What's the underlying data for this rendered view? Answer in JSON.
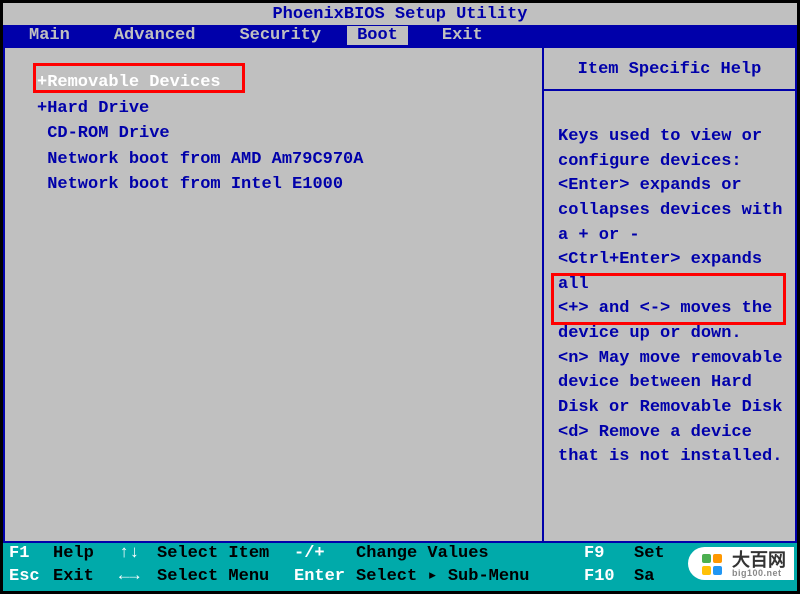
{
  "title": "PhoenixBIOS Setup Utility",
  "menu": {
    "items": [
      "Main",
      "Advanced",
      "Security",
      "Boot",
      "Exit"
    ],
    "active_index": 3
  },
  "boot_order": {
    "items": [
      {
        "prefix": "+",
        "label": "Removable Devices",
        "selected": true
      },
      {
        "prefix": "+",
        "label": "Hard Drive",
        "selected": false
      },
      {
        "prefix": " ",
        "label": "CD-ROM Drive",
        "selected": false
      },
      {
        "prefix": " ",
        "label": "Network boot from AMD Am79C970A",
        "selected": false
      },
      {
        "prefix": " ",
        "label": "Network boot from Intel E1000",
        "selected": false
      }
    ]
  },
  "help": {
    "title": "Item Specific Help",
    "body_lines": [
      "Keys used to view or",
      "configure devices:",
      "<Enter> expands or",
      "collapses devices with",
      "a + or -",
      "<Ctrl+Enter> expands",
      "all",
      "<+> and <-> moves the",
      "device up or down.",
      "<n> May move removable",
      "device between Hard",
      "Disk or Removable Disk",
      "<d> Remove a device",
      "that is not installed."
    ]
  },
  "footer": {
    "rows": [
      {
        "k1": "F1",
        "l1": "Help",
        "arrows": "↑↓",
        "al": "Select Item",
        "k2": "-/+",
        "l2": "Change Values",
        "k3": "F9",
        "l3": "Set"
      },
      {
        "k1": "Esc",
        "l1": "Exit",
        "arrows": "←→",
        "al": "Select Menu",
        "k2": "Enter",
        "l2": "Select ▸ Sub-Menu",
        "k3": "F10",
        "l3": "Sa"
      }
    ]
  },
  "watermark": {
    "brand": "大百网",
    "domain": "big100.net"
  }
}
